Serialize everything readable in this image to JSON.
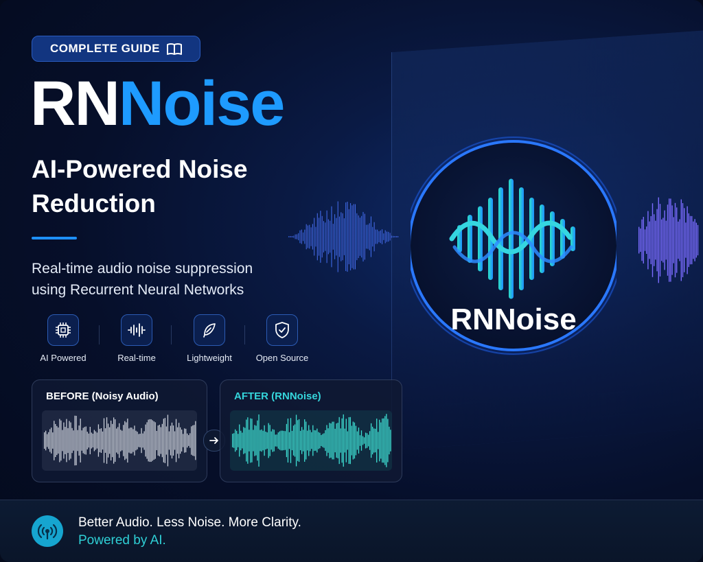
{
  "badge": {
    "label": "COMPLETE GUIDE",
    "icon": "book-icon"
  },
  "title": {
    "part1": "RN",
    "part2": "Noise"
  },
  "subtitle": {
    "line1": "AI-Powered Noise",
    "line2": "Reduction"
  },
  "description": {
    "line1": "Real-time audio noise suppression",
    "line2": "using Recurrent Neural Networks"
  },
  "features": [
    {
      "label": "AI Powered",
      "icon": "chip-icon"
    },
    {
      "label": "Real-time",
      "icon": "waveform-icon"
    },
    {
      "label": "Lightweight",
      "icon": "feather-icon"
    },
    {
      "label": "Open Source",
      "icon": "shield-check-icon"
    }
  ],
  "comparison": {
    "before": {
      "label": "BEFORE (Noisy Audio)"
    },
    "after": {
      "label": "AFTER (RNNoise)"
    }
  },
  "logo": {
    "text": "RNNoise"
  },
  "footer": {
    "tagline": "Better Audio. Less Noise. More Clarity.",
    "powered": "Powered by AI."
  },
  "colors": {
    "accent": "#1e9bff",
    "teal": "#2fd0d6",
    "background": "#060f2a"
  }
}
